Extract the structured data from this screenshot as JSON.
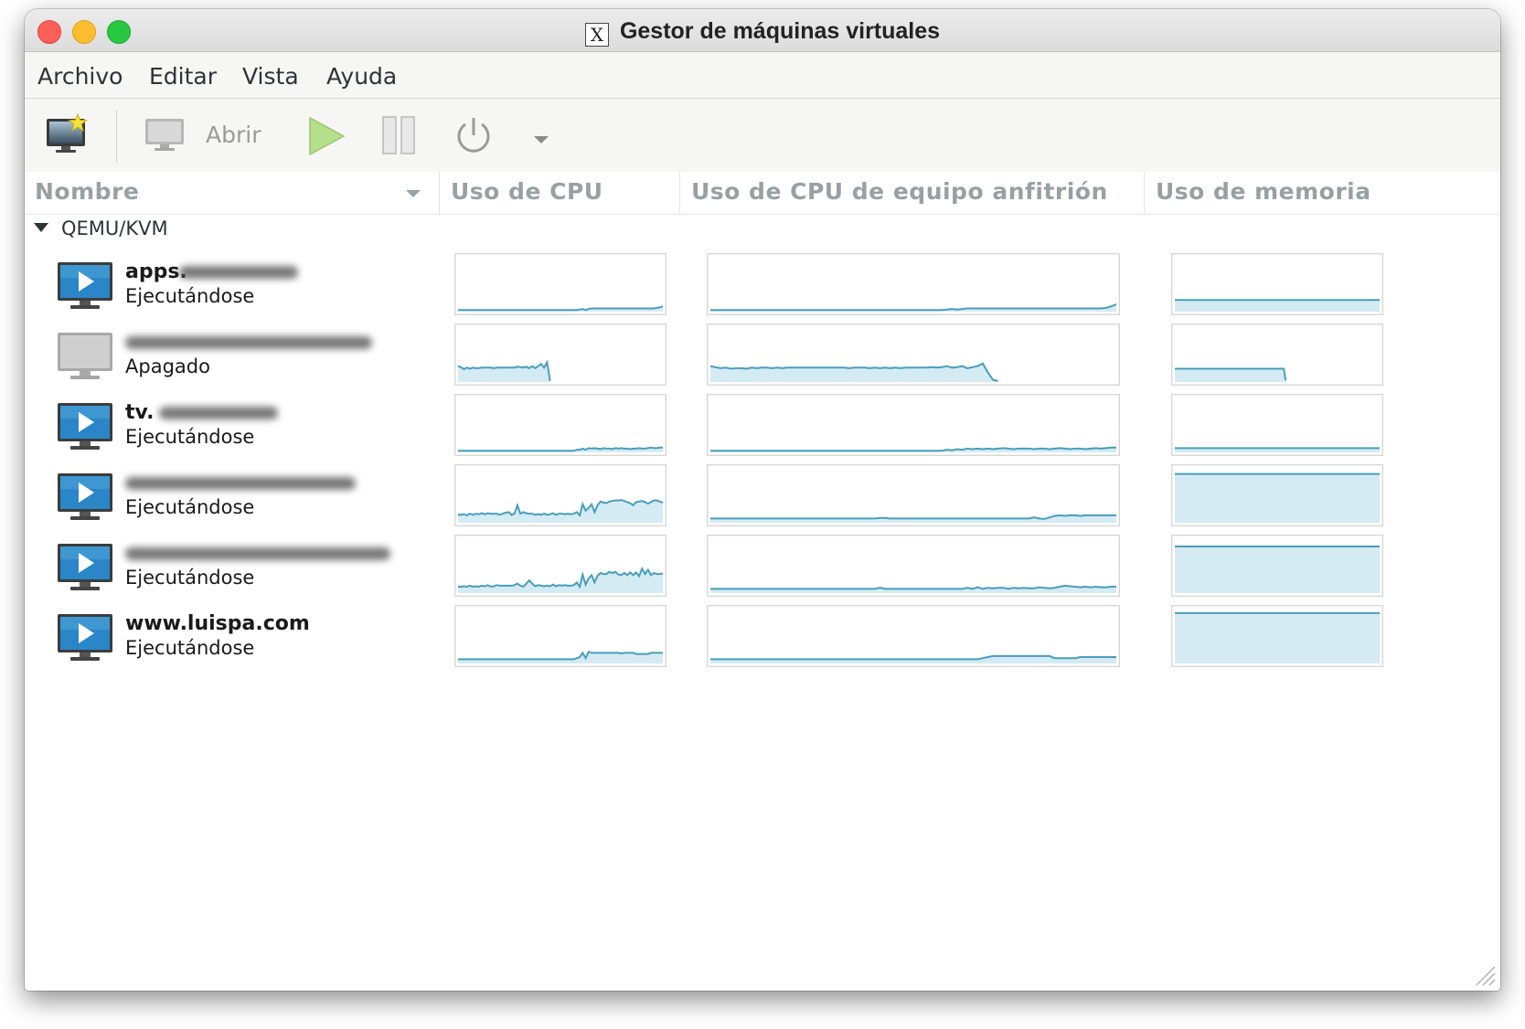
{
  "window": {
    "title": "Gestor de máquinas virtuales",
    "title_icon": "X"
  },
  "menu": [
    "Archivo",
    "Editar",
    "Vista",
    "Ayuda"
  ],
  "toolbar": {
    "new_vm_icon": "new-vm-icon",
    "open_label": "Abrir",
    "open_icon": "monitor-icon",
    "run_icon": "play-icon",
    "pause_icon": "pause-icon",
    "shutdown_icon": "power-icon",
    "menu_icon": "dropdown-arrow-icon"
  },
  "columns": [
    "Nombre",
    "Uso de CPU",
    "Uso de CPU de equipo anfitrión",
    "Uso de memoria"
  ],
  "group": "QEMU/KVM",
  "vms": [
    {
      "name": "apps.",
      "status": "Ejecutándose",
      "running": true,
      "cpu": [
        0.03,
        0.03,
        0.03,
        0.03,
        0.03,
        0.03,
        0.03,
        0.03,
        0.03,
        0.03,
        0.03,
        0.03,
        0.03,
        0.03,
        0.03,
        0.03,
        0.03,
        0.03,
        0.03,
        0.03,
        0.03,
        0.03,
        0.03,
        0.03,
        0.03,
        0.03,
        0.03,
        0.03,
        0.03,
        0.03,
        0.03,
        0.03,
        0.03,
        0.03,
        0.03,
        0.03,
        0.03,
        0.03,
        0.03,
        0.03,
        0.03,
        0.04,
        0.05,
        0.03,
        0.05,
        0.06,
        0.06,
        0.06,
        0.06,
        0.06,
        0.06,
        0.06,
        0.06,
        0.06,
        0.06,
        0.06,
        0.06,
        0.06,
        0.06,
        0.06,
        0.06,
        0.06,
        0.06,
        0.06,
        0.06,
        0.06,
        0.06,
        0.07,
        0.08,
        0.1
      ],
      "host": [
        0.03,
        0.03,
        0.03,
        0.03,
        0.03,
        0.03,
        0.03,
        0.03,
        0.03,
        0.03,
        0.03,
        0.03,
        0.03,
        0.03,
        0.03,
        0.03,
        0.03,
        0.03,
        0.03,
        0.03,
        0.03,
        0.03,
        0.03,
        0.03,
        0.03,
        0.03,
        0.03,
        0.03,
        0.03,
        0.03,
        0.03,
        0.03,
        0.03,
        0.03,
        0.03,
        0.03,
        0.03,
        0.03,
        0.03,
        0.03,
        0.03,
        0.03,
        0.03,
        0.03,
        0.03,
        0.03,
        0.04,
        0.05,
        0.04,
        0.05,
        0.06,
        0.06,
        0.06,
        0.06,
        0.06,
        0.06,
        0.06,
        0.06,
        0.06,
        0.06,
        0.06,
        0.06,
        0.06,
        0.06,
        0.06,
        0.06,
        0.06,
        0.06,
        0.06,
        0.06,
        0.06,
        0.06,
        0.06,
        0.06,
        0.06,
        0.06,
        0.06,
        0.07,
        0.1,
        0.14
      ],
      "mem": [
        0.22,
        0.22,
        0.22,
        0.22,
        0.22,
        0.22,
        0.22,
        0.22,
        0.22,
        0.22,
        0.22,
        0.22,
        0.22,
        0.22,
        0.22,
        0.22,
        0.22,
        0.22,
        0.22,
        0.22
      ]
    },
    {
      "name": "",
      "status": "Apagado",
      "running": false,
      "cpu": [
        0.3,
        0.28,
        0.24,
        0.27,
        0.25,
        0.27,
        0.26,
        0.26,
        0.27,
        0.27,
        0.27,
        0.27,
        0.26,
        0.27,
        0.27,
        0.27,
        0.27,
        0.27,
        0.27,
        0.27,
        0.29,
        0.28,
        0.27,
        0.29,
        0.26,
        0.3,
        0.26,
        0.3,
        0.34,
        0.27,
        0.37,
        0.02,
        null,
        null,
        null,
        null,
        null,
        null,
        null,
        null,
        null,
        null,
        null,
        null,
        null,
        null,
        null,
        null,
        null,
        null,
        null,
        null,
        null,
        null,
        null,
        null,
        null,
        null,
        null,
        null,
        null,
        null,
        null,
        null,
        null,
        null,
        null,
        null,
        null,
        null
      ],
      "host": [
        0.3,
        0.28,
        0.26,
        0.27,
        0.25,
        0.26,
        0.26,
        0.25,
        0.27,
        0.26,
        0.27,
        0.27,
        0.26,
        0.27,
        0.26,
        0.27,
        0.27,
        0.27,
        0.27,
        0.27,
        0.27,
        0.27,
        0.27,
        0.27,
        0.27,
        0.27,
        0.27,
        0.26,
        0.27,
        0.27,
        0.27,
        0.26,
        0.27,
        0.26,
        0.27,
        0.26,
        0.27,
        0.26,
        0.27,
        0.27,
        0.27,
        0.27,
        0.27,
        0.28,
        0.27,
        0.28,
        0.3,
        0.27,
        0.28,
        0.3,
        0.26,
        0.28,
        0.3,
        0.35,
        0.18,
        0.04,
        0.02,
        null,
        null,
        null,
        null,
        null,
        null,
        null,
        null,
        null,
        null,
        null,
        null,
        null,
        null,
        null,
        null,
        null,
        null,
        null,
        null,
        null,
        null,
        null
      ],
      "mem": [
        0.25,
        0.25,
        0.25,
        0.25,
        0.25,
        0.25,
        0.25,
        0.25,
        0.25,
        0.25,
        0.25,
        0.25,
        0.25,
        0.25,
        0.25,
        0.25,
        0.25,
        0.25,
        0.25,
        0.25,
        0.25,
        0.25,
        0.25,
        0.25,
        0.25,
        0.25,
        0.25,
        0.25,
        0.25,
        0.25,
        0.25,
        0.25,
        0.25,
        0.25,
        0.25,
        0.25,
        0.25,
        0.25,
        0.25,
        0.25,
        0.25,
        0.25,
        0.25,
        0.25,
        0.25,
        0.25,
        0.25,
        0.25,
        0.25,
        0.25,
        0.25,
        0.25,
        0.25,
        0.25,
        0.25,
        0.25,
        0.25,
        0.25,
        0.25,
        0.03,
        null,
        null,
        null,
        null,
        null,
        null,
        null,
        null,
        null,
        null,
        null,
        null,
        null,
        null,
        null,
        null,
        null,
        null,
        null,
        null,
        null,
        null,
        null,
        null,
        null,
        null,
        null,
        null,
        null,
        null,
        null,
        null,
        null,
        null,
        null,
        null,
        null,
        null,
        null,
        null,
        null,
        null,
        null,
        null,
        null,
        null,
        null,
        null,
        null,
        null
      ]
    },
    {
      "name": "tv.",
      "status": "Ejecutándose",
      "running": true,
      "cpu": [
        0.03,
        0.03,
        0.03,
        0.03,
        0.03,
        0.03,
        0.03,
        0.03,
        0.03,
        0.03,
        0.03,
        0.03,
        0.03,
        0.03,
        0.03,
        0.03,
        0.03,
        0.03,
        0.03,
        0.03,
        0.03,
        0.03,
        0.03,
        0.03,
        0.03,
        0.03,
        0.03,
        0.03,
        0.03,
        0.03,
        0.03,
        0.03,
        0.03,
        0.03,
        0.03,
        0.03,
        0.03,
        0.03,
        0.03,
        0.03,
        0.05,
        0.05,
        0.07,
        0.05,
        0.08,
        0.07,
        0.08,
        0.07,
        0.06,
        0.08,
        0.07,
        0.07,
        0.06,
        0.08,
        0.07,
        0.08,
        0.07,
        0.07,
        0.06,
        0.07,
        0.07,
        0.08,
        0.07,
        0.07,
        0.08,
        0.09,
        0.08,
        0.08,
        0.09,
        0.09
      ],
      "host": [
        0.03,
        0.03,
        0.03,
        0.03,
        0.03,
        0.03,
        0.03,
        0.03,
        0.03,
        0.03,
        0.03,
        0.03,
        0.03,
        0.03,
        0.03,
        0.03,
        0.03,
        0.03,
        0.03,
        0.03,
        0.03,
        0.03,
        0.03,
        0.03,
        0.03,
        0.03,
        0.03,
        0.03,
        0.03,
        0.03,
        0.03,
        0.03,
        0.03,
        0.03,
        0.03,
        0.03,
        0.03,
        0.03,
        0.03,
        0.03,
        0.03,
        0.03,
        0.03,
        0.03,
        0.03,
        0.03,
        0.05,
        0.04,
        0.06,
        0.05,
        0.07,
        0.06,
        0.07,
        0.06,
        0.07,
        0.06,
        0.07,
        0.08,
        0.07,
        0.06,
        0.07,
        0.07,
        0.07,
        0.06,
        0.07,
        0.07,
        0.06,
        0.07,
        0.08,
        0.07,
        0.06,
        0.07,
        0.07,
        0.06,
        0.07,
        0.08,
        0.07,
        0.08,
        0.09,
        0.09
      ],
      "mem": [
        0.08,
        0.08,
        0.08,
        0.08,
        0.08,
        0.08,
        0.08,
        0.08,
        0.08,
        0.08,
        0.08,
        0.08,
        0.08,
        0.08,
        0.08,
        0.08,
        0.08,
        0.08,
        0.08,
        0.08
      ]
    },
    {
      "name": "",
      "status": "Ejecutándose",
      "running": true,
      "cpu": [
        0.15,
        0.15,
        0.16,
        0.14,
        0.17,
        0.15,
        0.17,
        0.16,
        0.18,
        0.16,
        0.18,
        0.17,
        0.17,
        0.17,
        0.15,
        0.17,
        0.19,
        0.2,
        0.15,
        0.17,
        0.33,
        0.17,
        0.2,
        0.18,
        0.17,
        0.17,
        0.15,
        0.16,
        0.15,
        0.17,
        0.15,
        0.16,
        0.18,
        0.15,
        0.17,
        0.17,
        0.16,
        0.17,
        0.16,
        0.17,
        0.2,
        0.14,
        0.35,
        0.23,
        0.28,
        0.35,
        0.2,
        0.33,
        0.4,
        0.38,
        0.37,
        0.4,
        0.41,
        0.42,
        0.42,
        0.43,
        0.41,
        0.39,
        0.37,
        0.33,
        0.39,
        0.4,
        0.41,
        0.39,
        0.36,
        0.39,
        0.42,
        0.42,
        0.4,
        0.38
      ],
      "host": [
        0.08,
        0.08,
        0.08,
        0.08,
        0.08,
        0.08,
        0.08,
        0.08,
        0.08,
        0.08,
        0.08,
        0.08,
        0.08,
        0.08,
        0.08,
        0.08,
        0.08,
        0.08,
        0.08,
        0.08,
        0.08,
        0.08,
        0.08,
        0.08,
        0.08,
        0.08,
        0.08,
        0.08,
        0.08,
        0.08,
        0.08,
        0.08,
        0.08,
        0.09,
        0.09,
        0.08,
        0.08,
        0.08,
        0.08,
        0.08,
        0.08,
        0.08,
        0.08,
        0.08,
        0.08,
        0.08,
        0.08,
        0.08,
        0.08,
        0.08,
        0.08,
        0.08,
        0.08,
        0.08,
        0.08,
        0.08,
        0.08,
        0.08,
        0.08,
        0.08,
        0.08,
        0.08,
        0.08,
        0.1,
        0.08,
        0.07,
        0.1,
        0.13,
        0.14,
        0.13,
        0.14,
        0.14,
        0.13,
        0.14,
        0.14,
        0.14,
        0.14,
        0.14,
        0.14,
        0.14
      ],
      "mem": [
        0.92,
        0.92,
        0.92,
        0.92,
        0.92,
        0.92,
        0.92,
        0.92,
        0.92,
        0.92,
        0.92,
        0.92,
        0.92,
        0.92,
        0.92,
        0.92,
        0.92,
        0.92,
        0.92,
        0.92
      ]
    },
    {
      "name": "",
      "status": "Ejecutándose",
      "running": true,
      "cpu": [
        0.12,
        0.12,
        0.13,
        0.12,
        0.14,
        0.12,
        0.13,
        0.12,
        0.14,
        0.13,
        0.15,
        0.12,
        0.13,
        0.15,
        0.14,
        0.14,
        0.14,
        0.14,
        0.14,
        0.15,
        0.18,
        0.14,
        0.12,
        0.18,
        0.24,
        0.18,
        0.13,
        0.15,
        0.14,
        0.13,
        0.14,
        0.13,
        0.16,
        0.13,
        0.15,
        0.14,
        0.15,
        0.14,
        0.14,
        0.15,
        0.2,
        0.12,
        0.35,
        0.16,
        0.28,
        0.34,
        0.2,
        0.33,
        0.38,
        0.36,
        0.36,
        0.4,
        0.38,
        0.4,
        0.35,
        0.34,
        0.38,
        0.34,
        0.39,
        0.34,
        0.39,
        0.32,
        0.46,
        0.36,
        0.44,
        0.34,
        0.38,
        0.36,
        0.36,
        0.37
      ],
      "host": [
        0.08,
        0.08,
        0.08,
        0.08,
        0.08,
        0.08,
        0.08,
        0.08,
        0.08,
        0.08,
        0.08,
        0.08,
        0.08,
        0.08,
        0.08,
        0.08,
        0.08,
        0.08,
        0.08,
        0.08,
        0.08,
        0.08,
        0.08,
        0.08,
        0.08,
        0.08,
        0.08,
        0.08,
        0.08,
        0.08,
        0.08,
        0.08,
        0.08,
        0.1,
        0.08,
        0.08,
        0.08,
        0.08,
        0.08,
        0.08,
        0.08,
        0.08,
        0.08,
        0.08,
        0.08,
        0.08,
        0.08,
        0.08,
        0.08,
        0.08,
        0.1,
        0.08,
        0.11,
        0.08,
        0.1,
        0.09,
        0.1,
        0.1,
        0.08,
        0.1,
        0.09,
        0.1,
        0.09,
        0.09,
        0.11,
        0.1,
        0.09,
        0.1,
        0.12,
        0.14,
        0.13,
        0.12,
        0.11,
        0.12,
        0.11,
        0.12,
        0.11,
        0.11,
        0.12,
        0.12
      ],
      "mem": [
        0.88,
        0.88,
        0.88,
        0.88,
        0.88,
        0.88,
        0.88,
        0.88,
        0.88,
        0.88,
        0.88,
        0.88,
        0.88,
        0.88,
        0.88,
        0.88,
        0.88,
        0.88,
        0.88,
        0.88
      ]
    },
    {
      "name": "www.luispa.com",
      "status": "Ejecutándose",
      "running": true,
      "cpu": [
        0.08,
        0.08,
        0.08,
        0.08,
        0.08,
        0.08,
        0.08,
        0.08,
        0.08,
        0.08,
        0.08,
        0.08,
        0.08,
        0.08,
        0.08,
        0.08,
        0.08,
        0.08,
        0.08,
        0.08,
        0.08,
        0.08,
        0.08,
        0.08,
        0.08,
        0.08,
        0.08,
        0.08,
        0.08,
        0.08,
        0.08,
        0.08,
        0.08,
        0.08,
        0.08,
        0.08,
        0.08,
        0.08,
        0.08,
        0.08,
        0.1,
        0.12,
        0.2,
        0.1,
        0.22,
        0.2,
        0.2,
        0.2,
        0.2,
        0.2,
        0.2,
        0.2,
        0.2,
        0.2,
        0.2,
        0.19,
        0.2,
        0.2,
        0.2,
        0.2,
        0.18,
        0.18,
        0.18,
        0.18,
        0.18,
        0.2,
        0.2,
        0.2,
        0.2,
        0.2
      ],
      "host": [
        0.08,
        0.08,
        0.08,
        0.08,
        0.08,
        0.08,
        0.08,
        0.08,
        0.08,
        0.08,
        0.08,
        0.08,
        0.08,
        0.08,
        0.08,
        0.08,
        0.08,
        0.08,
        0.08,
        0.08,
        0.08,
        0.08,
        0.08,
        0.08,
        0.08,
        0.08,
        0.08,
        0.08,
        0.08,
        0.08,
        0.08,
        0.08,
        0.08,
        0.08,
        0.08,
        0.08,
        0.08,
        0.08,
        0.08,
        0.08,
        0.08,
        0.08,
        0.08,
        0.08,
        0.08,
        0.08,
        0.08,
        0.08,
        0.08,
        0.08,
        0.08,
        0.08,
        0.08,
        0.1,
        0.12,
        0.14,
        0.14,
        0.14,
        0.14,
        0.14,
        0.14,
        0.14,
        0.14,
        0.14,
        0.14,
        0.14,
        0.14,
        0.1,
        0.1,
        0.1,
        0.1,
        0.1,
        0.12,
        0.12,
        0.12,
        0.12,
        0.12,
        0.12,
        0.12,
        0.12
      ],
      "mem": [
        0.95,
        0.95,
        0.95,
        0.95,
        0.95,
        0.95,
        0.95,
        0.95,
        0.95,
        0.95,
        0.95,
        0.95,
        0.95,
        0.95,
        0.95,
        0.95,
        0.95,
        0.95,
        0.95,
        0.95
      ]
    }
  ],
  "colors": {
    "graph_line": "#4a9dbb",
    "graph_fill": "#d4ebf3",
    "monitor_screen": "#2a86c6"
  }
}
